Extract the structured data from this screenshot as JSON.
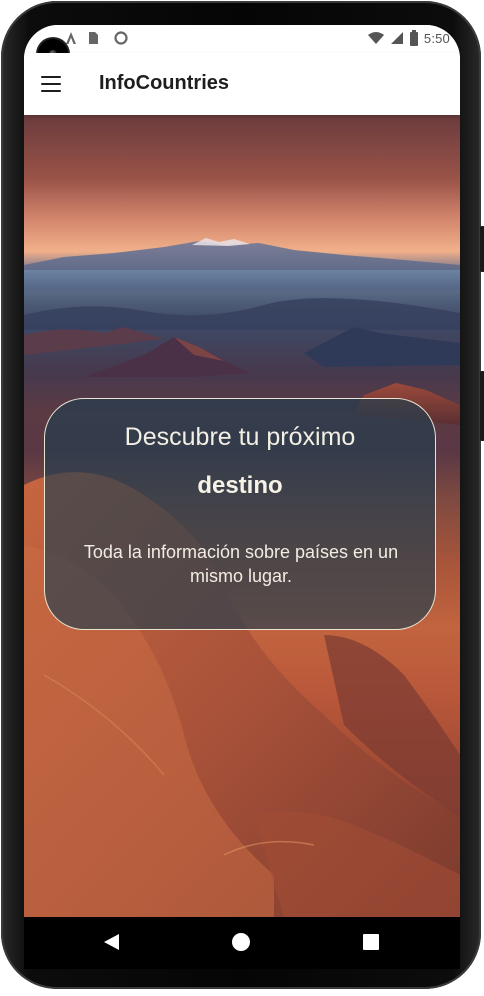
{
  "status_bar": {
    "time": "5:50",
    "left_icons": [
      "notification-a-icon",
      "sim-card-icon",
      "sync-circle-icon"
    ],
    "right_icons": [
      "wifi-icon",
      "signal-icon",
      "battery-icon"
    ]
  },
  "app_bar": {
    "title": "InfoCountries",
    "menu_icon": "hamburger-menu-icon"
  },
  "hero": {
    "heading": "Descubre tu próximo",
    "heading_strong": "destino",
    "description": "Toda la información sobre países en un mismo lugar."
  },
  "nav_bar": {
    "buttons": [
      "back-icon",
      "home-icon",
      "recent-apps-icon"
    ]
  },
  "colors": {
    "card_background": "#213e4f",
    "card_border": "#e9e3cf",
    "card_text": "#f3efe4",
    "app_bar_background": "#ffffff",
    "title_text": "#1e1e1e"
  }
}
